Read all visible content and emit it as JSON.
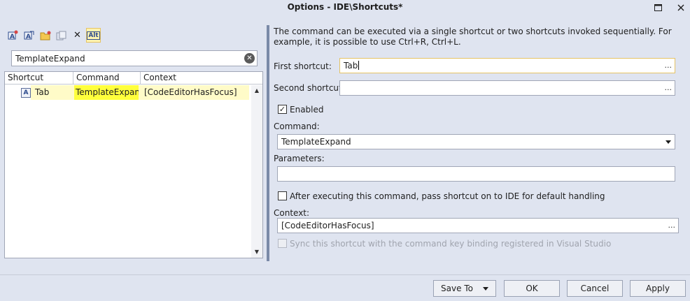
{
  "window": {
    "title": "Options - IDE\\Shortcuts*"
  },
  "toolbar": {
    "icons": [
      "add-shortcut-icon",
      "add-shortcut-variant-icon",
      "open-folder-icon",
      "copy-icon",
      "delete-icon",
      "alt-toggle-icon"
    ],
    "delete_glyph": "✕",
    "alt_label": "Alt"
  },
  "search": {
    "value": "TemplateExpand",
    "clear_glyph": "✕"
  },
  "table": {
    "columns": [
      "Shortcut",
      "Command",
      "Context"
    ],
    "rows": [
      {
        "icon_letter": "A",
        "shortcut": "Tab",
        "command": "TemplateExpand",
        "context": "[CodeEditorHasFocus]"
      }
    ]
  },
  "details": {
    "description": "The command can be executed via a single shortcut or two shortcuts invoked sequentially. For example, it is possible to use Ctrl+R, Ctrl+L.",
    "first_shortcut_label": "First shortcut:",
    "first_shortcut_value": "Tab",
    "second_shortcut_label": "Second shortcut:",
    "second_shortcut_value": "",
    "ellipsis": "...",
    "enabled_label": "Enabled",
    "enabled_checked": true,
    "check_glyph": "✓",
    "command_label": "Command:",
    "command_value": "TemplateExpand",
    "parameters_label": "Parameters:",
    "parameters_value": "",
    "pass_shortcut_label": "After executing this command, pass shortcut on to IDE for default handling",
    "pass_shortcut_checked": false,
    "context_label": "Context:",
    "context_value": "[CodeEditorHasFocus]",
    "sync_label": "Sync this shortcut with the command key binding registered in Visual Studio",
    "sync_checked": false
  },
  "footer": {
    "save_to_label": "Save To",
    "ok_label": "OK",
    "cancel_label": "Cancel",
    "apply_label": "Apply"
  },
  "colors": {
    "background": "#dfe4f0",
    "row_highlight": "#fffbc8",
    "match_highlight": "#ffff3c",
    "splitter": "#7a8aa8"
  }
}
